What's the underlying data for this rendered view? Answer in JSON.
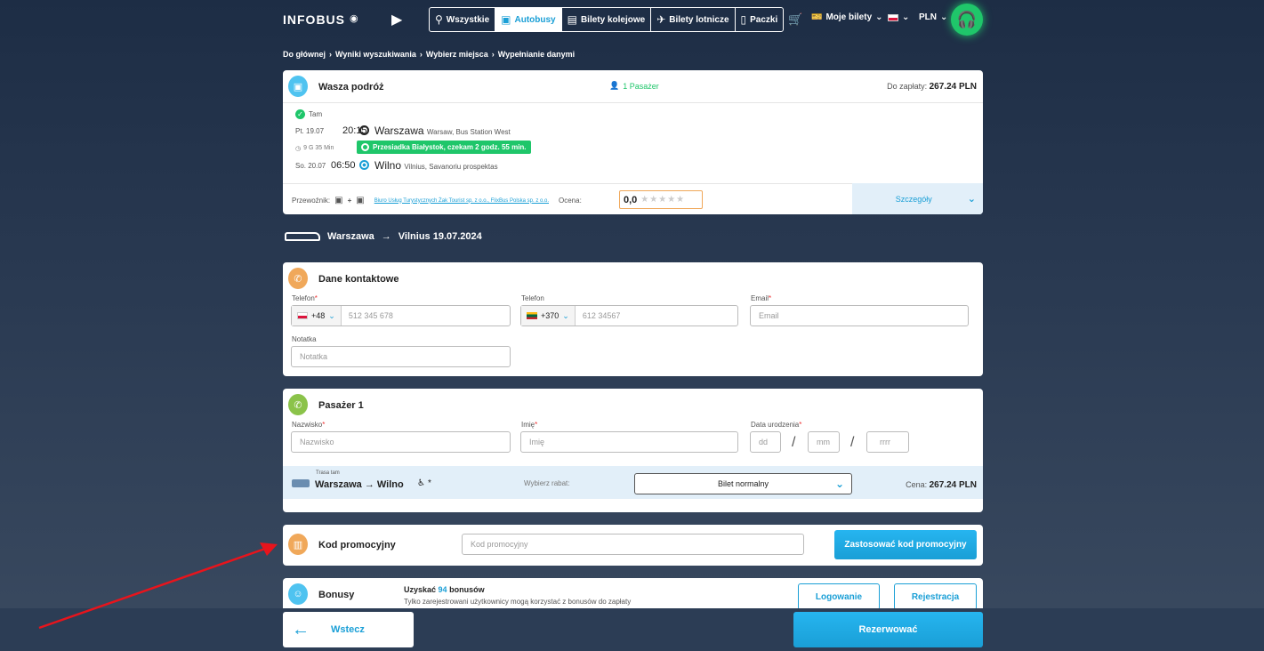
{
  "header": {
    "logo": "INFOBUS",
    "tabs": [
      {
        "label": "Wszystkie",
        "icon": "bike-icon"
      },
      {
        "label": "Autobusy",
        "icon": "bus-icon"
      },
      {
        "label": "Bilety kolejowe",
        "icon": "train-icon"
      },
      {
        "label": "Bilety lotnicze",
        "icon": "plane-icon"
      },
      {
        "label": "Paczki",
        "icon": "package-icon"
      }
    ],
    "my_tickets": "Moje bilety",
    "currency": "PLN"
  },
  "breadcrumb": [
    "Do głównej",
    "Wyniki wyszukiwania",
    "Wybierz miejsca",
    "Wypełnianie danymi"
  ],
  "trip": {
    "title": "Wasza podróż",
    "passengers": "1 Pasażer",
    "to_pay_label": "Do zapłaty:",
    "to_pay_value": "267.24 PLN",
    "direction": "Tam",
    "dep_date": "Pt. 19.07",
    "dep_time": "20:15",
    "dep_city": "Warszawa",
    "dep_station": "Warsaw, Bus Station West",
    "duration": "9 G 35 Min",
    "transfer": "Przesiadka Białystok, czekam 2 godz. 55 min.",
    "arr_date": "So. 20.07",
    "arr_time": "06:50",
    "arr_city": "Wilno",
    "arr_station": "Vilnius, Savanoriu prospektas",
    "carrier_label": "Przewoźnik:",
    "carrier_link": "Biuro Usług Turystycznych Żak Tourist sp. z o.o., FlixBus Polska sp. z o.o.",
    "rating_label": "Ocena:",
    "rating_value": "0,0",
    "details": "Szczegóły"
  },
  "route_line": {
    "from": "Warszawa",
    "to": "Vilnius 19.07.2024"
  },
  "contact": {
    "title": "Dane kontaktowe",
    "phone_label": "Telefon",
    "phone_code": "+48",
    "phone_placeholder": "512 345 678",
    "phone2_label": "Telefon",
    "phone2_code": "+370",
    "phone2_placeholder": "612 34567",
    "email_label": "Email",
    "email_placeholder": "Email",
    "note_label": "Notatka",
    "note_placeholder": "Notatka"
  },
  "passenger": {
    "title": "Pasażer 1",
    "surname_label": "Nazwisko",
    "surname_placeholder": "Nazwisko",
    "name_label": "Imię",
    "name_placeholder": "Imię",
    "dob_label": "Data urodzenia",
    "dd": "dd",
    "mm": "mm",
    "yyyy": "rrrr",
    "route_small": "Trasa tam",
    "route": "Warszawa → Wilno",
    "seat": "*",
    "discount_label": "Wybierz rabat:",
    "discount_value": "Bilet normalny",
    "price_label": "Cena:",
    "price_value": "267.24 PLN"
  },
  "promo": {
    "title": "Kod promocyjny",
    "placeholder": "Kod promocyjny",
    "apply": "Zastosować kod promocyjny"
  },
  "bonus": {
    "title": "Bonusy",
    "earn_prefix": "Uzyskać",
    "earn_count": "94",
    "earn_suffix": "bonusów",
    "note": "Tylko zarejestrowani użytkownicy mogą korzystać z bonusów do zapłaty",
    "login": "Logowanie",
    "register": "Rejestracja"
  },
  "footer": {
    "back": "Wstecz",
    "reserve": "Rezerwować"
  },
  "colors": {
    "accent": "#1a9fd6",
    "green": "#1fc66a",
    "orange": "#f0a85a",
    "annotation": "#e8141c"
  }
}
